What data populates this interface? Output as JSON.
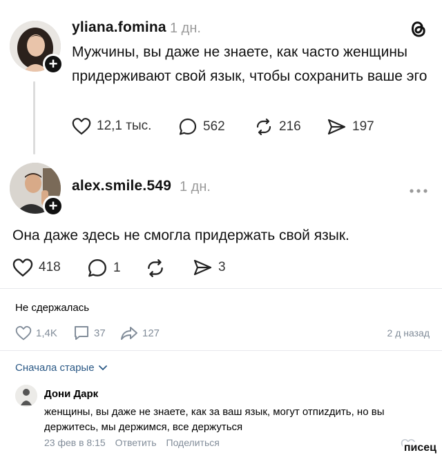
{
  "post1": {
    "username": "yliana.fomina",
    "time": "1 дн.",
    "text": "Мужчины, вы даже не знаете, как часто женщины придерживают свой язык, чтобы сохранить ваше эго",
    "likes": "12,1 тыс.",
    "comments": "562",
    "reposts": "216",
    "shares": "197",
    "logo_icon": "threads-logo"
  },
  "post2": {
    "username": "alex.smile.549",
    "time": "1 дн.",
    "more_icon": "more-dots-icon",
    "text": "Она даже здесь не смогла придержать свой язык.",
    "likes": "418",
    "comments": "1",
    "shares": "3"
  },
  "vk": {
    "caption": "Не сдержалась",
    "likes": "1,4K",
    "comments": "37",
    "shares": "127",
    "date": "2 д назад",
    "sort_label": "Сначала старые",
    "comment": {
      "author": "Дони Дарк",
      "text": "женщины, вы даже не знаете, как за ваш язык, могут отпиzдить, но вы держитесь, мы держимся, все держуться",
      "date": "23 фев в 8:15",
      "reply": "Ответить",
      "share": "Поделиться"
    }
  },
  "watermark": "писец",
  "colors": {
    "vk_link": "#2a5885",
    "vk_gray": "#818c99",
    "threads_gray": "#9a9a9a"
  }
}
